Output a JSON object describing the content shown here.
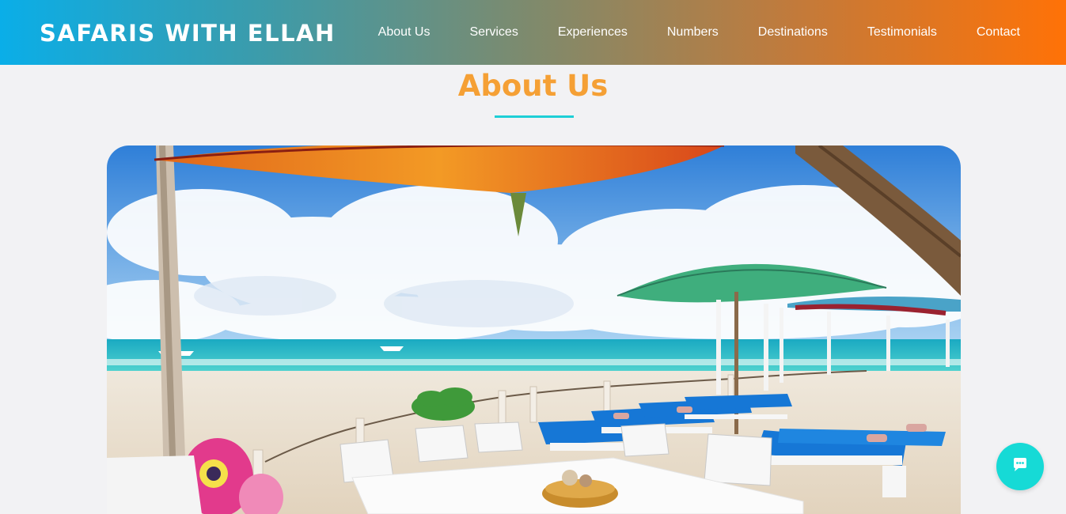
{
  "header": {
    "brand": "SAFARIS WITH ELLAH",
    "nav": [
      {
        "label": "About Us"
      },
      {
        "label": "Services"
      },
      {
        "label": "Experiences"
      },
      {
        "label": "Numbers"
      },
      {
        "label": "Destinations"
      },
      {
        "label": "Testimonials"
      },
      {
        "label": "Contact"
      }
    ]
  },
  "about": {
    "title": "About Us",
    "image_subject": "beach-lounge-photo"
  },
  "chat": {
    "icon": "chat-bubble-icon"
  },
  "colors": {
    "header_gradient_start": "#0aaee8",
    "header_gradient_end": "#ff7207",
    "title": "#f5a035",
    "underline": "#1ecfd6",
    "chat_button": "#16dad6",
    "page_background": "#f2f2f4"
  }
}
